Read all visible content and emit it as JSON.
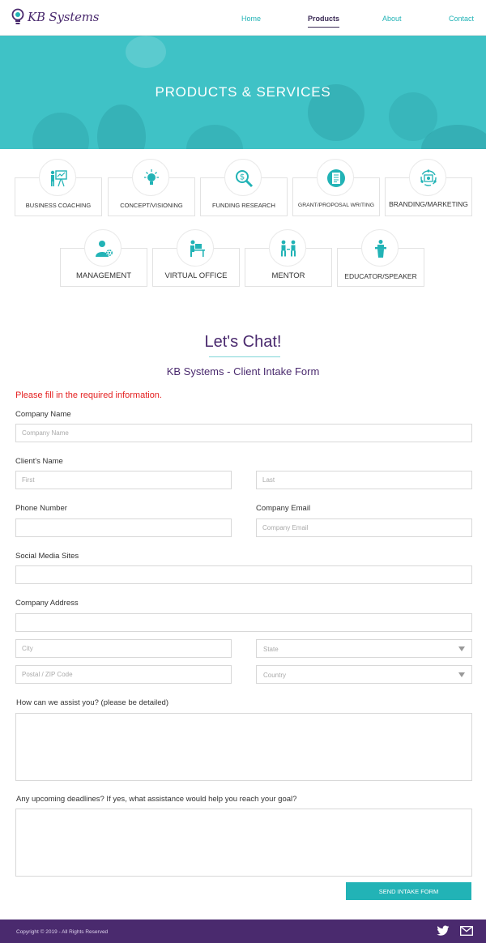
{
  "header": {
    "logo_text": "KB Systems",
    "nav": {
      "home": "Home",
      "products": "Products",
      "about": "About",
      "contact": "Contact"
    }
  },
  "hero": {
    "title": "PRODUCTS & SERVICES"
  },
  "services": {
    "business_coaching": "BUSINESS COACHING",
    "concept_visioning": "CONCEPT/VISIONING",
    "funding_research": "FUNDING RESEARCH",
    "grant_proposal": "GRANT/PROPOSAL WRITING",
    "branding_marketing": "BRANDING/MARKETING",
    "management": "MANAGEMENT",
    "virtual_office": "VIRTUAL OFFICE",
    "mentor": "MENTOR",
    "educator_speaker": "EDUCATOR/SPEAKER"
  },
  "form": {
    "heading": "Let's Chat!",
    "subheading": "KB Systems - Client Intake Form",
    "required_notice": "Please fill in the required information.",
    "company_name_label": "Company Name",
    "company_name_placeholder": "Company Name",
    "client_name_label": "Client's Name",
    "first_placeholder": "First",
    "last_placeholder": "Last",
    "phone_label": "Phone Number",
    "email_label": "Company Email",
    "email_placeholder": "Company Email",
    "social_label": "Social Media Sites",
    "address_label": "Company Address",
    "city_placeholder": "City",
    "state_value": "State",
    "zip_placeholder": "Postal / ZIP Code",
    "country_value": "Country",
    "assist_label": "How can we assist you? (please be detailed)",
    "deadlines_label": "Any upcoming deadlines? If yes, what assistance would help you reach your goal?",
    "submit_label": "SEND INTAKE FORM"
  },
  "footer": {
    "copyright": "Copyright © 2019 - All Rights Reserved",
    "icons": [
      "twitter-icon",
      "mail-icon"
    ]
  },
  "colors": {
    "teal": "#22b3b6",
    "purple": "#4a2a6e",
    "hero": "#3fc2c6",
    "error": "#e41f1f"
  }
}
